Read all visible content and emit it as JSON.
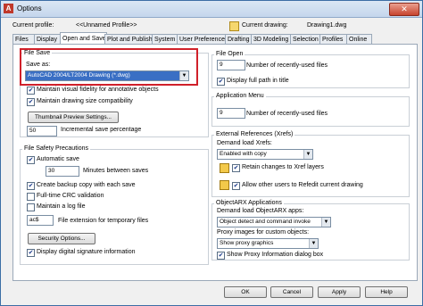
{
  "window": {
    "title": "Options",
    "close": "✕"
  },
  "header": {
    "profile_label": "Current profile:",
    "profile_value": "<<Unnamed Profile>>",
    "drawing_label": "Current drawing:",
    "drawing_value": "Drawing1.dwg"
  },
  "tabs": [
    "Files",
    "Display",
    "Open and Save",
    "Plot and Publish",
    "System",
    "User Preferences",
    "Drafting",
    "3D Modeling",
    "Selection",
    "Profiles",
    "Online"
  ],
  "active_tab": "Open and Save",
  "file_save": {
    "title": "File Save",
    "save_as_label": "Save as:",
    "save_as_value": "AutoCAD 2004/LT2004 Drawing (*.dwg)",
    "maintain_visual_fidelity": "Maintain visual fidelity for annotative objects",
    "maintain_drawing_size": "Maintain drawing size compatibility",
    "thumbnail_button": "Thumbnail Preview Settings...",
    "incremental_value": "50",
    "incremental_label": "Incremental save percentage"
  },
  "file_safety": {
    "title": "File Safety Precautions",
    "automatic_save": "Automatic save",
    "minutes_value": "30",
    "minutes_label": "Minutes between saves",
    "backup_copy": "Create backup copy with each save",
    "full_crc": "Full-time CRC validation",
    "log_file": "Maintain a log file",
    "temp_ext_value": "ac$",
    "temp_ext_label": "File extension for temporary files",
    "security_button": "Security Options...",
    "digital_signature": "Display digital signature information"
  },
  "file_open": {
    "title": "File Open",
    "recent_value": "9",
    "recent_label": "Number of recently-used files",
    "full_path": "Display full path in title"
  },
  "app_menu": {
    "title": "Application Menu",
    "recent_value": "9",
    "recent_label": "Number of recently-used files"
  },
  "xrefs": {
    "title": "External References (Xrefs)",
    "demand_label": "Demand load Xrefs:",
    "demand_value": "Enabled with copy",
    "retain_changes": "Retain changes to Xref layers",
    "allow_others": "Allow other users to Refedit current drawing"
  },
  "arx": {
    "title": "ObjectARX Applications",
    "demand_label": "Demand load ObjectARX apps:",
    "demand_value": "Object detect and command invoke",
    "proxy_label": "Proxy images for custom objects:",
    "proxy_value": "Show proxy graphics",
    "show_proxy_dialog": "Show Proxy Information dialog box"
  },
  "buttons": {
    "ok": "OK",
    "cancel": "Cancel",
    "apply": "Apply",
    "help": "Help"
  },
  "check": "✔"
}
